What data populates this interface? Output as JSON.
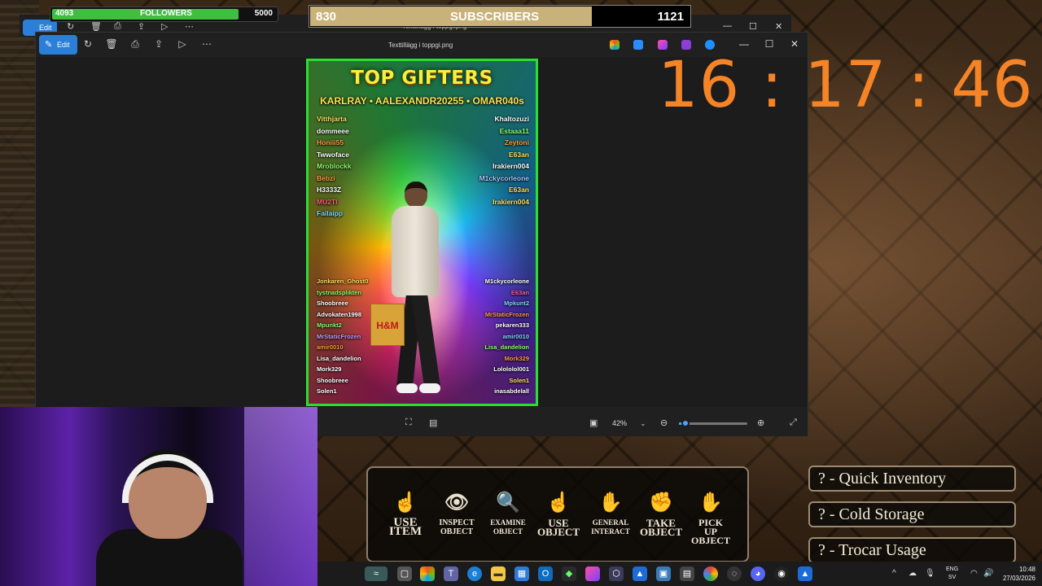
{
  "stream": {
    "followers": {
      "current": "4093",
      "label": "FOLLOWERS",
      "goal": "5000",
      "progress": 0.82
    },
    "subscribers": {
      "current": "830",
      "label": "SUBSCRIBERS",
      "goal": "1121",
      "progress": 0.74
    },
    "clock": "16 : 17 : 46"
  },
  "photos_window": {
    "title": "Texttillägg i toppgi.png",
    "edit_label": "Edit",
    "zoom": "42%",
    "zoom_fraction": 0.1
  },
  "poster": {
    "title": "TOP GIFTERS",
    "subtitle": "KARLRAY • AALEXANDR20255 • OMAR040s",
    "left_top": [
      {
        "name": "Vitthjarta",
        "color": "#ffe25a"
      },
      {
        "name": "dommeee",
        "color": "#ffffff"
      },
      {
        "name": "Honiii55",
        "color": "#ff9a3c"
      },
      {
        "name": "Twwoface",
        "color": "#ffffff"
      },
      {
        "name": "Mroblockk",
        "color": "#8cff6a"
      },
      {
        "name": "Bebzi",
        "color": "#ff9a3c"
      },
      {
        "name": "H3333Z",
        "color": "#ffffff"
      },
      {
        "name": "MU2TI",
        "color": "#ff5a7a"
      },
      {
        "name": "Failaipp",
        "color": "#7ad8ff"
      }
    ],
    "right_top": [
      {
        "name": "Khaltozuzi",
        "color": "#ffffff"
      },
      {
        "name": "Estaaa11",
        "color": "#8cff6a"
      },
      {
        "name": "Zeytoni",
        "color": "#ff9a3c"
      },
      {
        "name": "E63an",
        "color": "#ffe25a"
      },
      {
        "name": "Irakiern004",
        "color": "#ffffff"
      },
      {
        "name": "M1ckycorleone",
        "color": "#a9c8ff"
      },
      {
        "name": "E63an",
        "color": "#ffe25a"
      },
      {
        "name": "Irakiern004",
        "color": "#ffe25a"
      }
    ],
    "left_bottom": [
      {
        "name": "Jonkaren_Ghost0",
        "color": "#ffe25a"
      },
      {
        "name": "tystnadsplikten",
        "color": "#8cff6a"
      },
      {
        "name": "Shoobreee",
        "color": "#ffffff"
      },
      {
        "name": "Advokaten1998",
        "color": "#ffffff"
      },
      {
        "name": "Mpunkt2",
        "color": "#8cff6a"
      },
      {
        "name": "MrStaticFrozen",
        "color": "#c49bff"
      },
      {
        "name": "amir0010",
        "color": "#ff9a3c"
      },
      {
        "name": "Lisa_dandelion",
        "color": "#ffffff"
      },
      {
        "name": "Mork329",
        "color": "#ffffff"
      },
      {
        "name": "Shoobreee",
        "color": "#ffffff"
      },
      {
        "name": "Solen1",
        "color": "#ffffff"
      }
    ],
    "right_bottom": [
      {
        "name": "M1ckycorleone",
        "color": "#ffffff"
      },
      {
        "name": "E63an",
        "color": "#ff5aa8"
      },
      {
        "name": "Mpkunt2",
        "color": "#7ad8ff"
      },
      {
        "name": "MrStaticFrozen",
        "color": "#ff9a3c"
      },
      {
        "name": "pekaren333",
        "color": "#ffffff"
      },
      {
        "name": "amir0010",
        "color": "#7ad8ff"
      },
      {
        "name": "Lisa_dandelion",
        "color": "#8cff6a"
      },
      {
        "name": "Mork329",
        "color": "#ff9a3c"
      },
      {
        "name": "Lolololol001",
        "color": "#ffffff"
      },
      {
        "name": "Solen1",
        "color": "#ffe25a"
      },
      {
        "name": "inasabdelall",
        "color": "#ffffff"
      }
    ],
    "bag_text": "H&M"
  },
  "game": {
    "actions": [
      {
        "icon": "hand-pointer-icon",
        "glyph": "☝",
        "label1": "USE",
        "label2": "ITEM",
        "size": "15px"
      },
      {
        "icon": "eye-icon",
        "glyph": "👁",
        "label1": "INSPECT",
        "label2": "OBJECT",
        "size": "10px"
      },
      {
        "icon": "magnifier-icon",
        "glyph": "🔍",
        "label1": "EXAMINE",
        "label2": "OBJECT",
        "size": "9px"
      },
      {
        "icon": "hand-use-icon",
        "glyph": "☝",
        "label1": "USE",
        "label2": "OBJECT",
        "size": "13px"
      },
      {
        "icon": "hand-interact-icon",
        "glyph": "✋",
        "label1": "GENERAL",
        "label2": "INTERACT",
        "size": "9px"
      },
      {
        "icon": "hand-take-icon",
        "glyph": "✊",
        "label1": "TAKE",
        "label2": "OBJECT",
        "size": "13px"
      },
      {
        "icon": "hand-pickup-icon",
        "glyph": "✋",
        "label1": "PICK",
        "label2": "UP",
        "label3": "OBJECT",
        "size": "12px"
      }
    ],
    "keybinds": [
      {
        "label": "? - Quick Inventory"
      },
      {
        "label": "? - Cold Storage"
      },
      {
        "label": "? - Trocar Usage"
      }
    ]
  },
  "taskbar": {
    "lang": "ENG",
    "region": "SV",
    "time": "10:48",
    "date": "27/03/2026"
  }
}
